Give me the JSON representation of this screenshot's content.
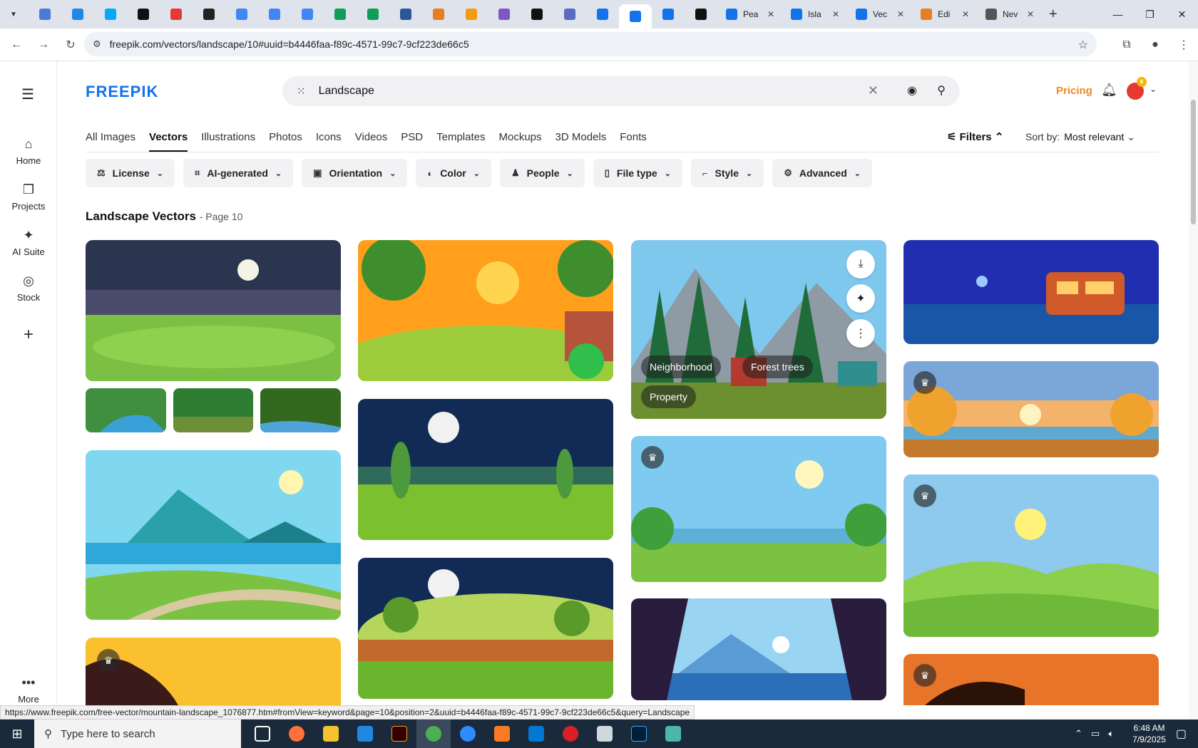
{
  "browser": {
    "tabs": [
      {
        "icon": "globe-icon",
        "color": "#4a7bd8"
      },
      {
        "icon": "v-icon",
        "color": "#1e88e5"
      },
      {
        "icon": "mosaic-icon",
        "color": "#03a9f4"
      },
      {
        "icon": "openai-icon",
        "color": "#111111"
      },
      {
        "icon": "youtube-icon",
        "color": "#e53935"
      },
      {
        "icon": "bolt-icon",
        "color": "#222222"
      },
      {
        "icon": "docs-icon",
        "color": "#4285f4"
      },
      {
        "icon": "docs-icon",
        "color": "#4285f4"
      },
      {
        "icon": "docs-icon",
        "color": "#4285f4"
      },
      {
        "icon": "sheets-icon",
        "color": "#0f9d58"
      },
      {
        "icon": "sheets-icon",
        "color": "#0f9d58"
      },
      {
        "icon": "word-icon",
        "color": "#2b579a"
      },
      {
        "icon": "box-icon",
        "color": "#e67e22"
      },
      {
        "icon": "ai-icon",
        "color": "#f39c12"
      },
      {
        "icon": "braces-icon",
        "color": "#7e57c2"
      },
      {
        "icon": "a-icon",
        "color": "#111111"
      },
      {
        "icon": "grid-icon",
        "color": "#5c6bc0"
      },
      {
        "icon": "freepik-icon",
        "color": "#1273eb"
      },
      {
        "icon": "freepik-icon",
        "color": "#1273eb",
        "active": true
      },
      {
        "icon": "freepik-icon",
        "color": "#1273eb"
      },
      {
        "icon": "m-icon",
        "color": "#111111"
      }
    ],
    "wide_tabs": [
      {
        "label": "Pea",
        "color": "#1273eb"
      },
      {
        "label": "Isla",
        "color": "#1273eb"
      },
      {
        "label": "Vec",
        "color": "#1273eb"
      },
      {
        "label": "Edi",
        "color": "#e67e22"
      },
      {
        "label": "Nev",
        "color": "#555555"
      }
    ],
    "url": "freepik.com/vectors/landscape/10#uuid=b4446faa-f89c-4571-99c7-9cf223de66c5",
    "status_url": "https://www.freepik.com/free-vector/mountain-landscape_1076877.htm#fromView=keyword&page=10&position=2&uuid=b4446faa-f89c-4571-99c7-9cf223de66c5&query=Landscape"
  },
  "sidebar": {
    "items": [
      {
        "label": "Home",
        "icon": "home-icon"
      },
      {
        "label": "Projects",
        "icon": "projects-icon"
      },
      {
        "label": "AI Suite",
        "icon": "sparkle-icon"
      },
      {
        "label": "Stock",
        "icon": "stock-icon"
      },
      {
        "label": "More",
        "icon": "more-icon"
      }
    ]
  },
  "header": {
    "logo": "FREEPIK",
    "search_value": "Landscape",
    "pricing": "Pricing"
  },
  "categories": [
    "All Images",
    "Vectors",
    "Illustrations",
    "Photos",
    "Icons",
    "Videos",
    "PSD",
    "Templates",
    "Mockups",
    "3D Models",
    "Fonts"
  ],
  "active_category": "Vectors",
  "filters_label": "Filters",
  "sort_label": "Sort by:",
  "sort_value": "Most relevant",
  "chips": [
    "License",
    "AI-generated",
    "Orientation",
    "Color",
    "People",
    "File type",
    "Style",
    "Advanced"
  ],
  "page_title": "Landscape Vectors",
  "page_sub": "- Page 10",
  "hover_tags": [
    "Neighborhood",
    "Forest trees",
    "Property"
  ],
  "taskbar": {
    "search_placeholder": "Type here to search",
    "time": "6:48 AM",
    "date": "7/9/2025"
  }
}
